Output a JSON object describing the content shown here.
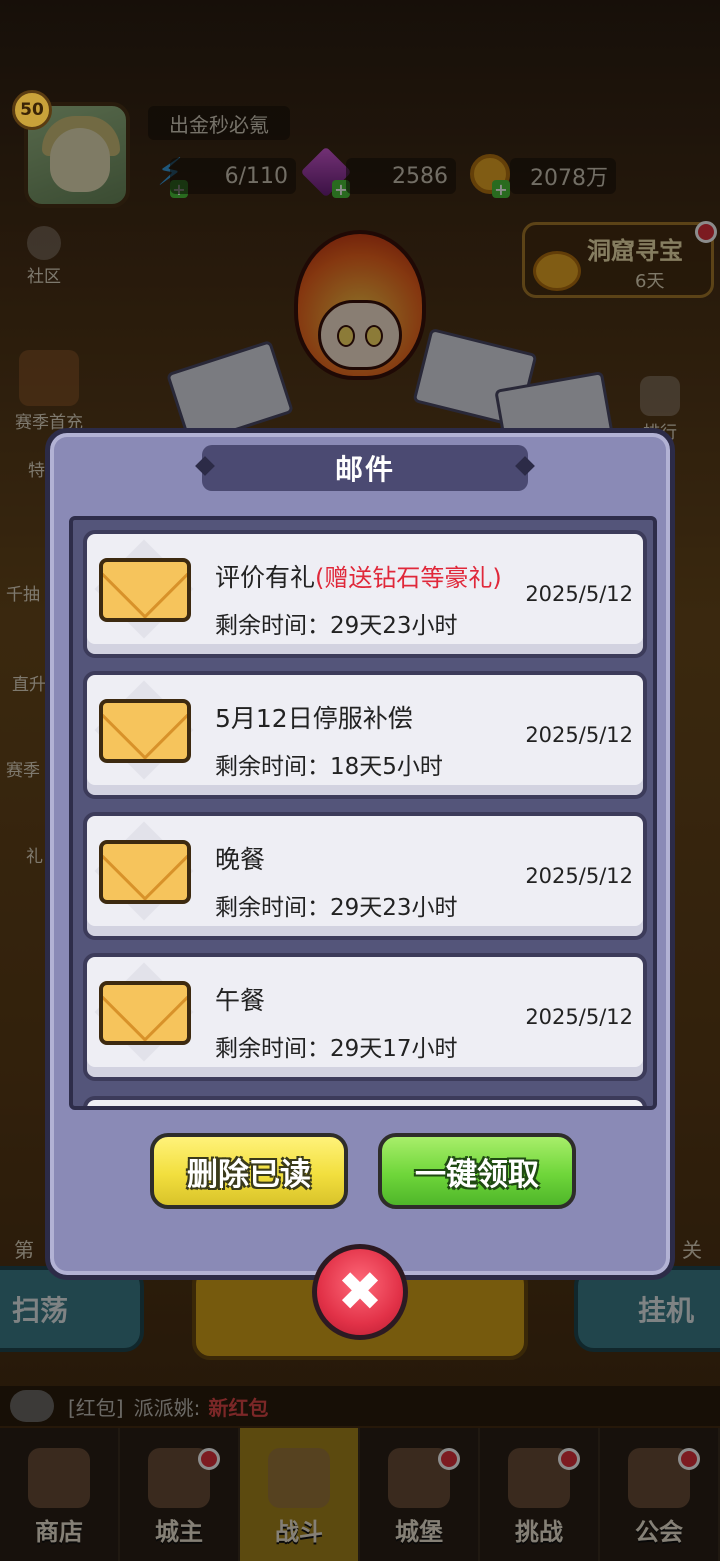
{
  "player": {
    "level": "50",
    "name": "出金秒必氪",
    "energy": "6/110",
    "gems": "2586",
    "gold": "2078万"
  },
  "hud": {
    "community_label": "社区",
    "treasure_title": "洞窟寻宝",
    "treasure_days": "6天",
    "season_first_label": "赛季首充",
    "left_labels": [
      "特",
      "千抽",
      "直升",
      "赛季",
      "礼"
    ],
    "rank_label": "排行",
    "stage_left": "第",
    "stage_right": "关"
  },
  "actions": {
    "sweep_label": "扫荡",
    "idle_label": "挂机"
  },
  "chat": {
    "tag": "[红包]",
    "user": "派派姚:",
    "message": "新红包"
  },
  "tabs": [
    {
      "label": "商店",
      "icon": "shop-icon",
      "active": false
    },
    {
      "label": "城主",
      "icon": "crown-icon",
      "active": false
    },
    {
      "label": "战斗",
      "icon": "swords-icon",
      "active": true
    },
    {
      "label": "城堡",
      "icon": "castle-icon",
      "active": false
    },
    {
      "label": "挑战",
      "icon": "demon-icon",
      "active": false
    },
    {
      "label": "公会",
      "icon": "guild-flag-icon",
      "active": false
    }
  ],
  "mail_dialog": {
    "title": "邮件",
    "mails": [
      {
        "title": "评价有礼",
        "promo": "(赠送钻石等豪礼)",
        "remaining_label": "剩余时间：",
        "remaining": "29天23小时",
        "date": "2025/5/12"
      },
      {
        "title": "5月12日停服补偿",
        "promo": "",
        "remaining_label": "剩余时间：",
        "remaining": "18天5小时",
        "date": "2025/5/12"
      },
      {
        "title": "晚餐",
        "promo": "",
        "remaining_label": "剩余时间：",
        "remaining": "29天23小时",
        "date": "2025/5/12"
      },
      {
        "title": "午餐",
        "promo": "",
        "remaining_label": "剩余时间：",
        "remaining": "29天17小时",
        "date": "2025/5/12"
      }
    ],
    "delete_read_label": "删除已读",
    "claim_all_label": "一键领取",
    "close_symbol": "✖"
  },
  "colors": {
    "dialog_bg": "#8a8ab6",
    "promo_text": "#e0283a",
    "delete_button": "#f2df3e",
    "claim_button": "#6fd63a",
    "close_button": "#e23248"
  }
}
